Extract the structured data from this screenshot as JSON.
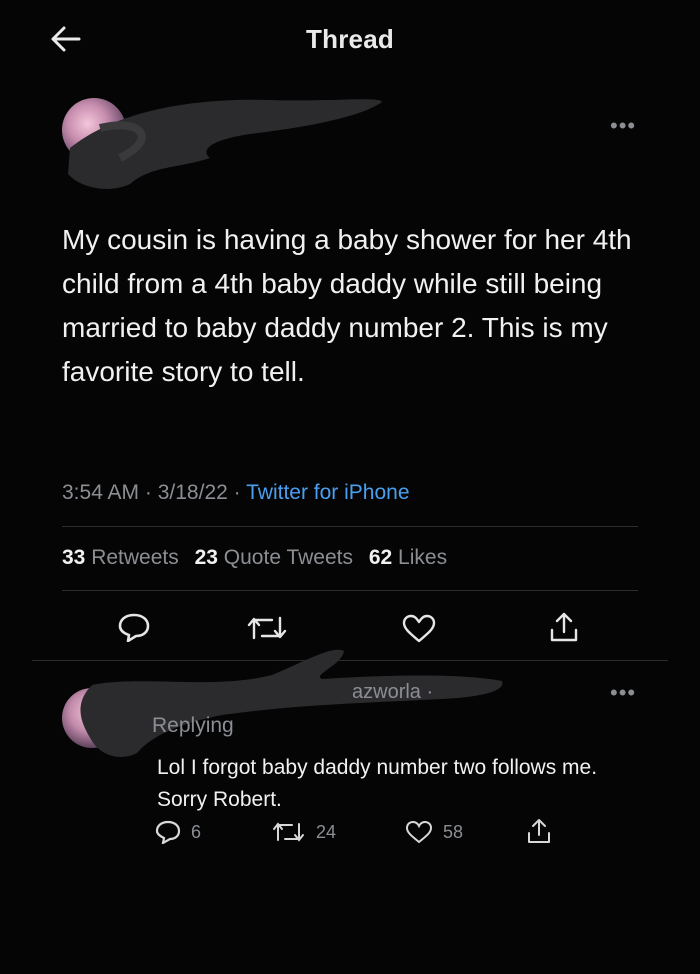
{
  "header": {
    "title": "Thread",
    "back_icon": "arrow-left-icon"
  },
  "tweet": {
    "text": "My cousin is having a baby shower for her 4th child from a 4th baby daddy while still being married to baby daddy number 2. This is my favorite story to tell.",
    "time": "3:54 AM",
    "date": "3/18/22",
    "source": "Twitter for iPhone",
    "retweets_count": "33",
    "retweets_label": "Retweets",
    "quotes_count": "23",
    "quotes_label": "Quote Tweets",
    "likes_count": "62",
    "likes_label": "Likes",
    "more": "•••"
  },
  "reply": {
    "handle_fragment": "azworla · ",
    "replying_fragment": "Replying ",
    "text": "Lol I forgot baby daddy number two follows me. Sorry Robert.",
    "replies": "6",
    "retweets": "24",
    "likes": "58",
    "more": "•••"
  },
  "colors": {
    "background": "#050505",
    "text": "#e7e9ea",
    "muted": "#8b8f93",
    "link": "#4a9ff0",
    "divider": "#2a2c2f"
  }
}
